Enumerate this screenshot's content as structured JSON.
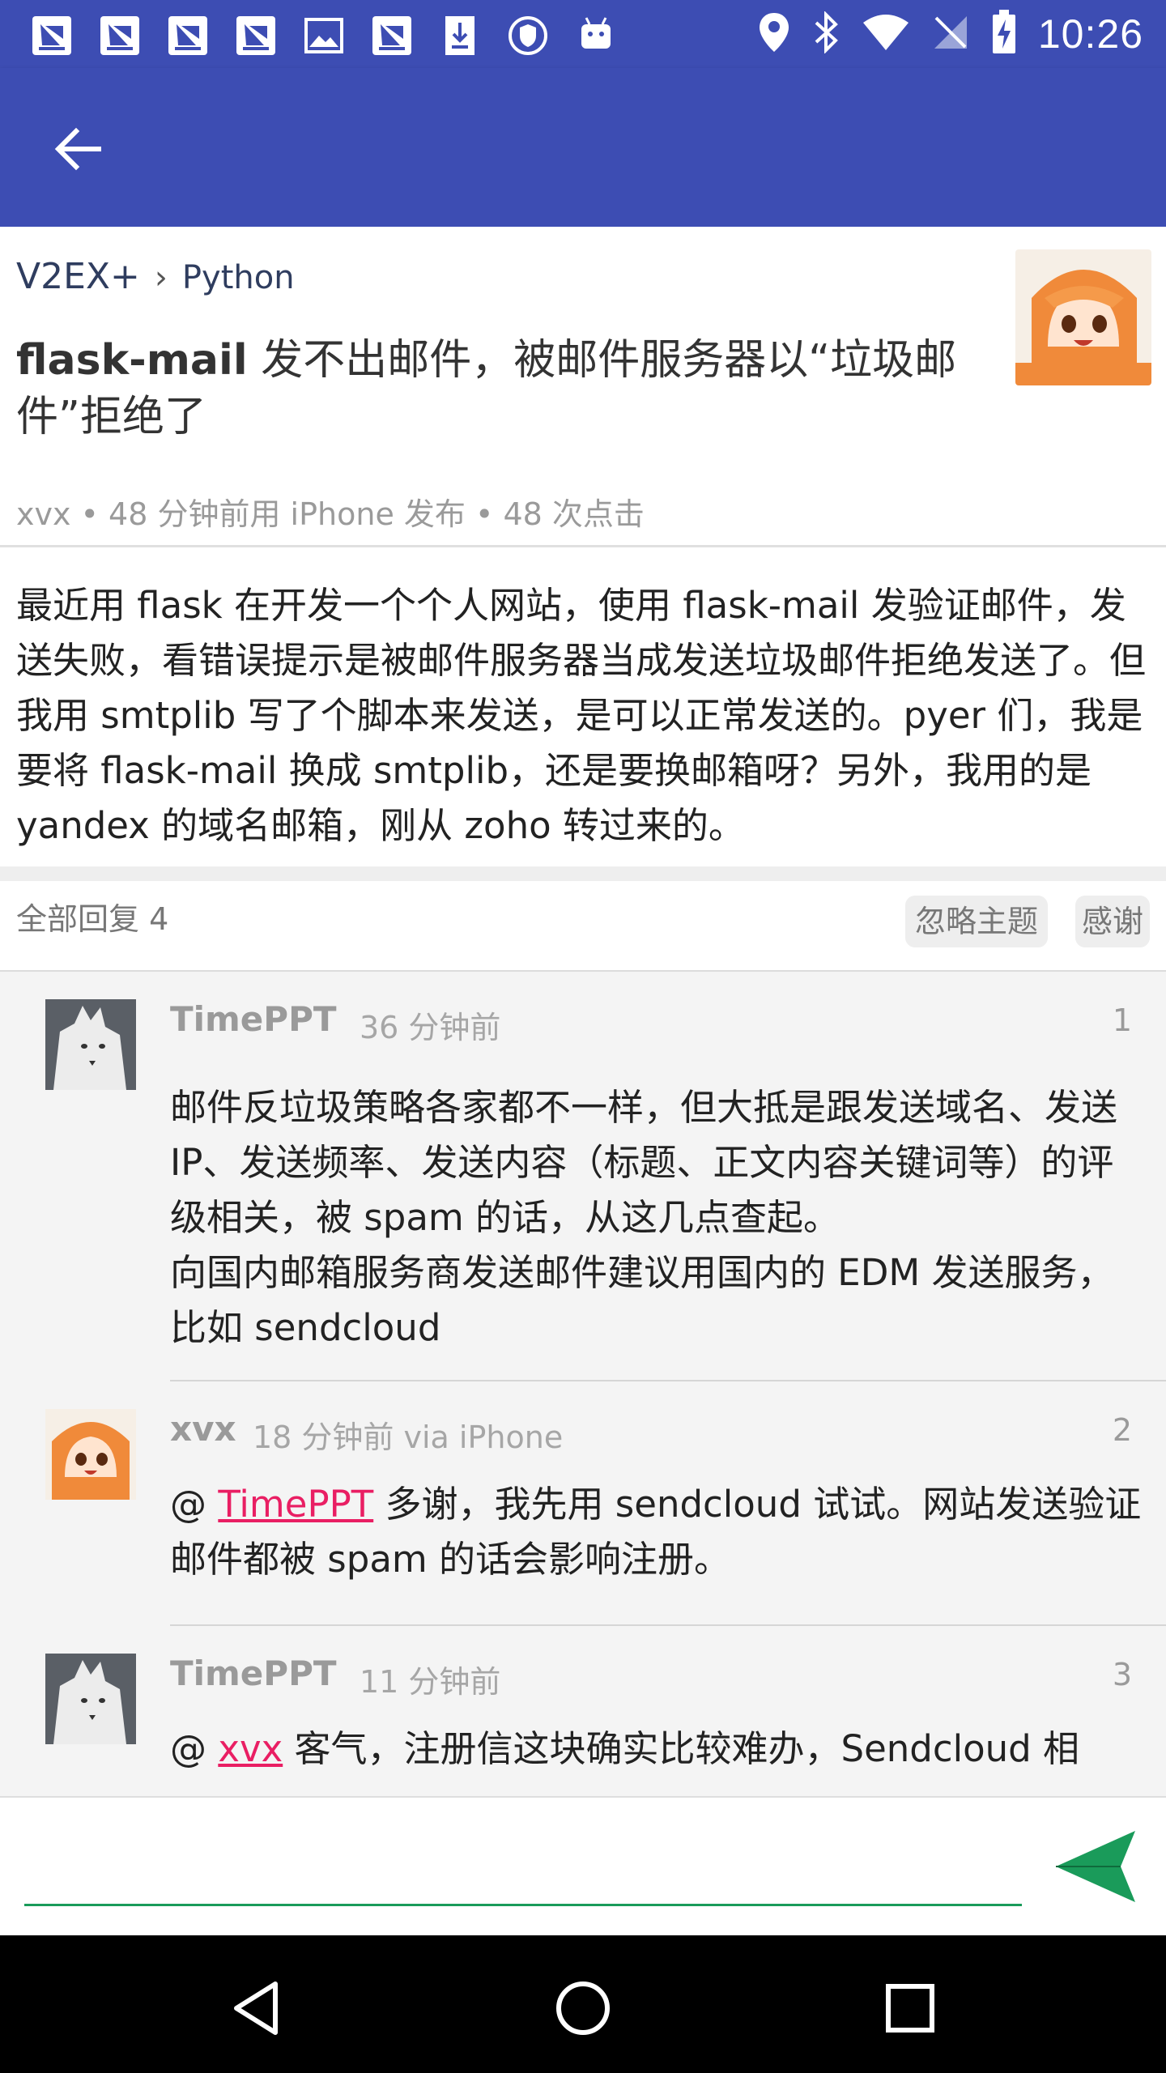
{
  "status_bar": {
    "time": "10:26",
    "left_icons": [
      "sailboat-icon",
      "sailboat-icon",
      "sailboat-icon",
      "sailboat-icon",
      "image-icon",
      "sailboat-icon",
      "download-icon",
      "shield-icon",
      "android-icon"
    ],
    "right_icons": [
      "location-icon",
      "bluetooth-icon",
      "wifi-icon",
      "no-sim-icon",
      "battery-charging-icon"
    ]
  },
  "app_bar": {
    "back_icon": "arrow-back-icon",
    "color": "#3d4db3"
  },
  "topic": {
    "site": "V2EX+",
    "separator": "›",
    "node": "Python",
    "title_strong": "flask-mail",
    "title_rest": " 发不出邮件，被邮件服务器以“垃圾邮件”拒绝了",
    "meta": "xvx • 48 分钟前用 iPhone 发布 • 48 次点击",
    "body": "最近用 flask 在开发一个个人网站，使用 flask-mail 发验证邮件，发送失败，看错误提示是被邮件服务器当成发送垃圾邮件拒绝发送了。但我用 smtplib 写了个脚本来发送，是可以正常发送的。pyer 们，我是要将 flask-mail 换成 smtplib，还是要换邮箱呀？另外，我用的是 yandex 的域名邮箱，刚从 zoho 转过来的。"
  },
  "replies_header": {
    "count_label": "全部回复 4",
    "ignore_label": "忽略主题",
    "thanks_label": "感谢"
  },
  "replies": [
    {
      "user": "TimePPT",
      "time": "36 分钟前",
      "floor": "1",
      "content": "邮件反垃圾策略各家都不一样，但大抵是跟发送域名、发送 IP、发送频率、发送内容（标题、正文内容关键词等）的评级相关，被 spam 的话，从这几点查起。\n向国内邮箱服务商发送邮件建议用国内的 EDM 发送服务，比如 sendcloud"
    },
    {
      "user": "xvx",
      "time": "18 分钟前 via iPhone",
      "floor": "2",
      "at": "@ ",
      "mention": "TimePPT",
      "content": " 多谢，我先用 sendcloud 试试。网站发送验证邮件都被 spam 的话会影响注册。"
    },
    {
      "user": "TimePPT",
      "time": "11 分钟前",
      "floor": "3",
      "at": "@ ",
      "mention": "xvx",
      "content": " 客气，注册信这块确实比较难办，Sendcloud 相"
    }
  ],
  "composer": {
    "placeholder": "",
    "send_icon": "send-icon",
    "accent": "#1a9b5a"
  },
  "nav_bar": {
    "back": "nav-back-icon",
    "home": "nav-home-icon",
    "recents": "nav-recents-icon"
  }
}
